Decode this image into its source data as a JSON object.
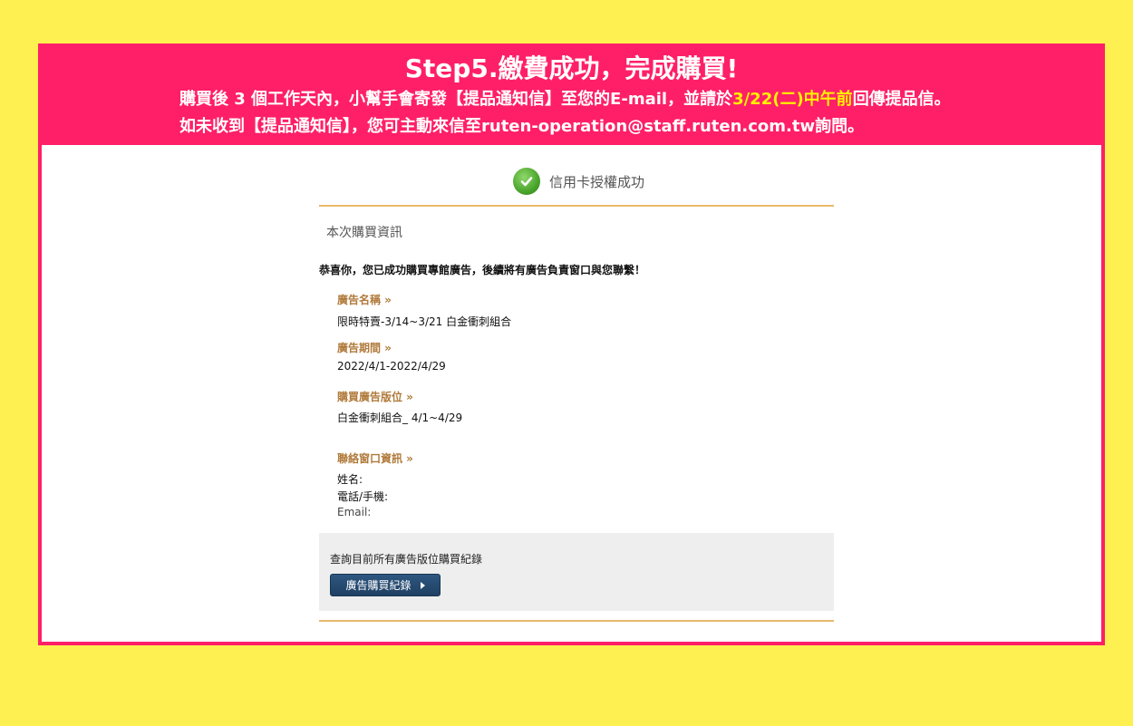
{
  "banner": {
    "title": "Step5.繳費成功，完成購買!",
    "line1_before": "購買後 3 個工作天內，小幫手會寄發【提品通知信】至您的E-mail，並請於",
    "line1_highlight": "3/22(二)中午前",
    "line1_after": "回傳提品信。",
    "line2": "如未收到【提品通知信】，您可主動來信至ruten-operation@staff.ruten.com.tw詢問。",
    "highlight_color": "#fff200"
  },
  "status": {
    "icon": "check-icon",
    "text": "信用卡授權成功"
  },
  "purchase_info": {
    "section_title": "本次購買資訊",
    "congrats": "恭喜你，您已成功購買專館廣告，後續將有廣告負責窗口與您聯繫！",
    "ad_name_label": "廣告名稱 »",
    "ad_name_value": "限時特賣-3/14~3/21 白金衝刺組合",
    "ad_period_label": "廣告期間 »",
    "ad_period_value": "2022/4/1-2022/4/29",
    "ad_slot_label": "購買廣告版位 »",
    "ad_slot_value": "白金衝刺組合_ 4/1~4/29",
    "contact_label": "聯絡窗口資訊 »",
    "contact_name": "姓名:",
    "contact_phone": "電話/手機:",
    "contact_email": "Email:"
  },
  "query": {
    "text": "查詢目前所有廣告版位購買紀錄",
    "button_label": "廣告購買紀錄"
  },
  "colors": {
    "page_bg": "#fef050",
    "banner_bg": "#ff1f68",
    "label": "#b07a3a",
    "rule": "#e8b96a",
    "button": "#1f4063"
  }
}
